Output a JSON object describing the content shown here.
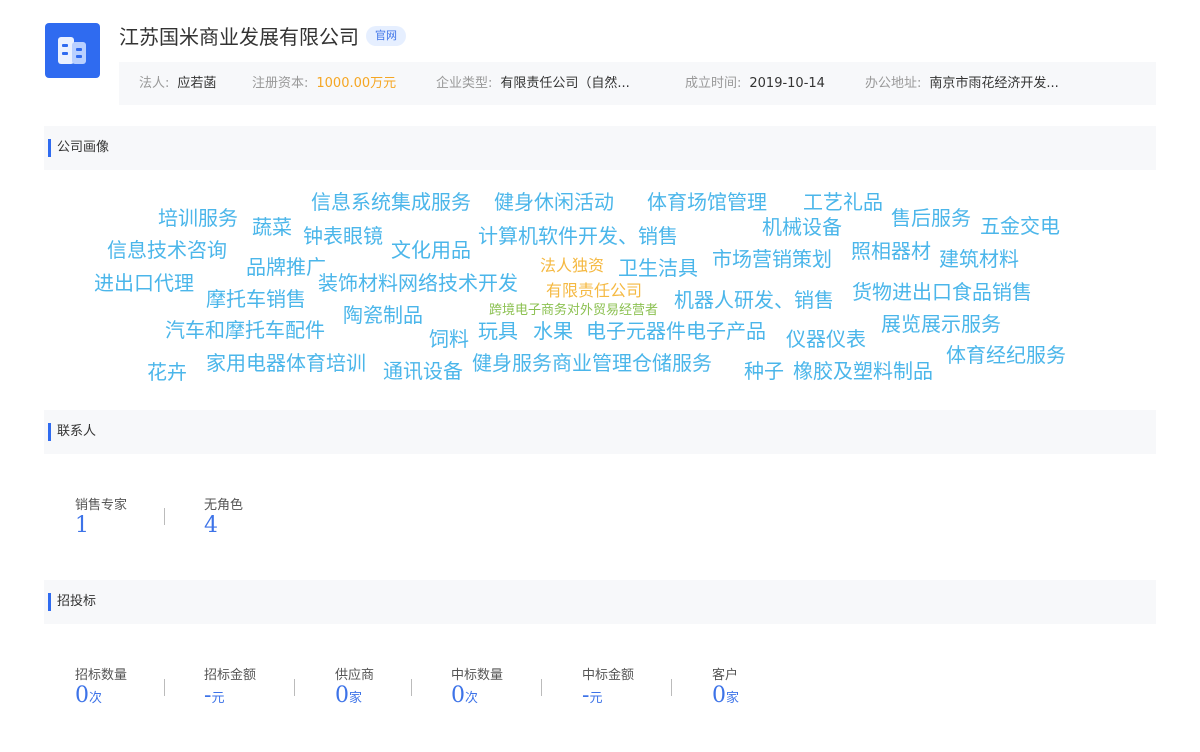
{
  "company": {
    "name": "江苏国米商业发展有限公司",
    "official_tag": "官网",
    "legal_person_label": "法人:",
    "legal_person": "应若菡",
    "capital_label": "注册资本:",
    "capital": "1000.00万元",
    "type_label": "企业类型:",
    "type": "有限责任公司（自然...",
    "founded_label": "成立时间:",
    "founded": "2019-10-14",
    "address_label": "办公地址:",
    "address": "南京市雨花经济开发..."
  },
  "portrait": {
    "title": "公司画像",
    "words": [
      {
        "text": "培训服务",
        "color": "#4bb6ea"
      },
      {
        "text": "蔬菜",
        "color": "#4bb6ea"
      },
      {
        "text": "信息系统集成服务",
        "color": "#4bb6ea"
      },
      {
        "text": "健身休闲活动",
        "color": "#4bb6ea"
      },
      {
        "text": "体育场馆管理",
        "color": "#4bb6ea"
      },
      {
        "text": "工艺礼品",
        "color": "#4bb6ea"
      },
      {
        "text": "售后服务",
        "color": "#4bb6ea"
      },
      {
        "text": "五金交电",
        "color": "#4bb6ea"
      },
      {
        "text": "钟表眼镜",
        "color": "#4bb6ea"
      },
      {
        "text": "信息技术咨询",
        "color": "#4bb6ea"
      },
      {
        "text": "文化用品",
        "color": "#4bb6ea"
      },
      {
        "text": "计算机软件开发、销售",
        "color": "#4bb6ea"
      },
      {
        "text": "机械设备",
        "color": "#4bb6ea"
      },
      {
        "text": "照相器材",
        "color": "#4bb6ea"
      },
      {
        "text": "建筑材料",
        "color": "#4bb6ea"
      },
      {
        "text": "品牌推广",
        "color": "#4bb6ea"
      },
      {
        "text": "市场营销策划",
        "color": "#4bb6ea"
      },
      {
        "text": "进出口代理",
        "color": "#4bb6ea"
      },
      {
        "text": "装饰材料网络技术开发",
        "color": "#4bb6ea"
      },
      {
        "text": "法人独资",
        "color": "#f5b942"
      },
      {
        "text": "卫生洁具",
        "color": "#4bb6ea"
      },
      {
        "text": "有限责任公司",
        "color": "#f5b942"
      },
      {
        "text": "货物进出口食品销售",
        "color": "#4bb6ea"
      },
      {
        "text": "摩托车销售",
        "color": "#4bb6ea"
      },
      {
        "text": "跨境电子商务对外贸易经营者",
        "color": "#8cc152"
      },
      {
        "text": "机器人研发、销售",
        "color": "#4bb6ea"
      },
      {
        "text": "陶瓷制品",
        "color": "#4bb6ea"
      },
      {
        "text": "展览展示服务",
        "color": "#4bb6ea"
      },
      {
        "text": "汽车和摩托车配件",
        "color": "#4bb6ea"
      },
      {
        "text": "饲料",
        "color": "#4bb6ea"
      },
      {
        "text": "玩具",
        "color": "#4bb6ea"
      },
      {
        "text": "水果",
        "color": "#4bb6ea"
      },
      {
        "text": "电子元器件电子产品",
        "color": "#4bb6ea"
      },
      {
        "text": "仪器仪表",
        "color": "#4bb6ea"
      },
      {
        "text": "体育经纪服务",
        "color": "#4bb6ea"
      },
      {
        "text": "家用电器体育培训",
        "color": "#4bb6ea"
      },
      {
        "text": "健身服务商业管理仓储服务",
        "color": "#4bb6ea"
      },
      {
        "text": "花卉",
        "color": "#4bb6ea"
      },
      {
        "text": "通讯设备",
        "color": "#4bb6ea"
      },
      {
        "text": "种子",
        "color": "#4bb6ea"
      },
      {
        "text": "橡胶及塑料制品",
        "color": "#4bb6ea"
      }
    ]
  },
  "contacts": {
    "title": "联系人",
    "items": [
      {
        "label": "销售专家",
        "value": "1"
      },
      {
        "label": "无角色",
        "value": "4"
      }
    ]
  },
  "bidding": {
    "title": "招投标",
    "items": [
      {
        "label": "招标数量",
        "value": "0",
        "unit": "次"
      },
      {
        "label": "招标金额",
        "value": "-",
        "unit": "元"
      },
      {
        "label": "供应商",
        "value": "0",
        "unit": "家"
      },
      {
        "label": "中标数量",
        "value": "0",
        "unit": "次"
      },
      {
        "label": "中标金额",
        "value": "-",
        "unit": "元"
      },
      {
        "label": "客户",
        "value": "0",
        "unit": "家"
      }
    ]
  }
}
